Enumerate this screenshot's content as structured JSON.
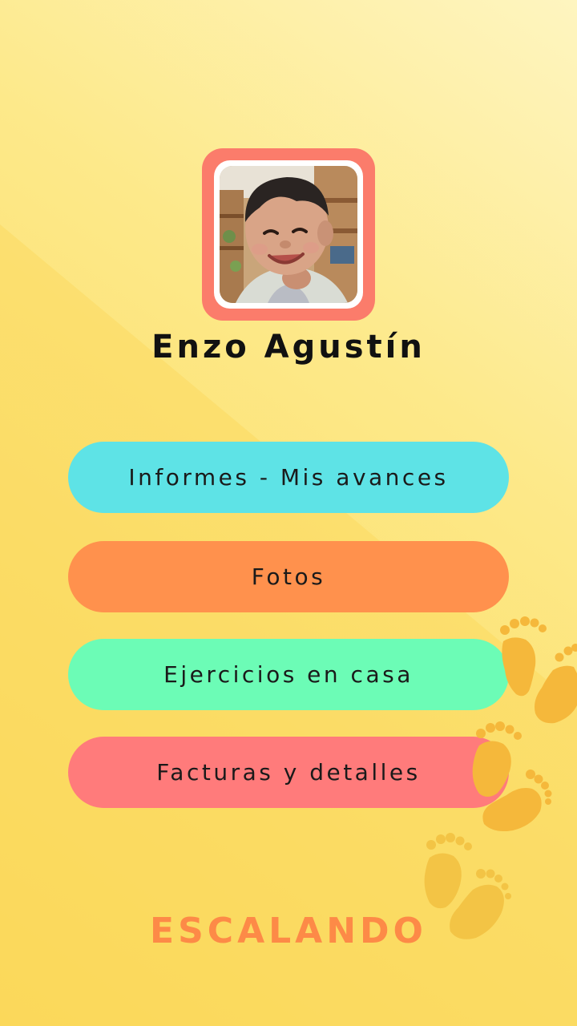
{
  "profile": {
    "name": "Enzo Agustín",
    "frame_color": "#fb7c6b"
  },
  "menu": {
    "items": [
      {
        "label": "Informes - Mis avances",
        "color": "#5ee3e6"
      },
      {
        "label": "Fotos",
        "color": "#ff914d"
      },
      {
        "label": "Ejercicios en casa",
        "color": "#6cfcb6"
      },
      {
        "label": "Facturas y detalles",
        "color": "#ff7b7b"
      }
    ]
  },
  "brand": {
    "text": "ESCALANDO",
    "color": "#fd8a47"
  },
  "decorations": {
    "icons": [
      "footprints-icon",
      "footprints-icon",
      "footprints-icon"
    ],
    "footprint_colors": [
      "#f5b83b",
      "#f3c445"
    ]
  }
}
